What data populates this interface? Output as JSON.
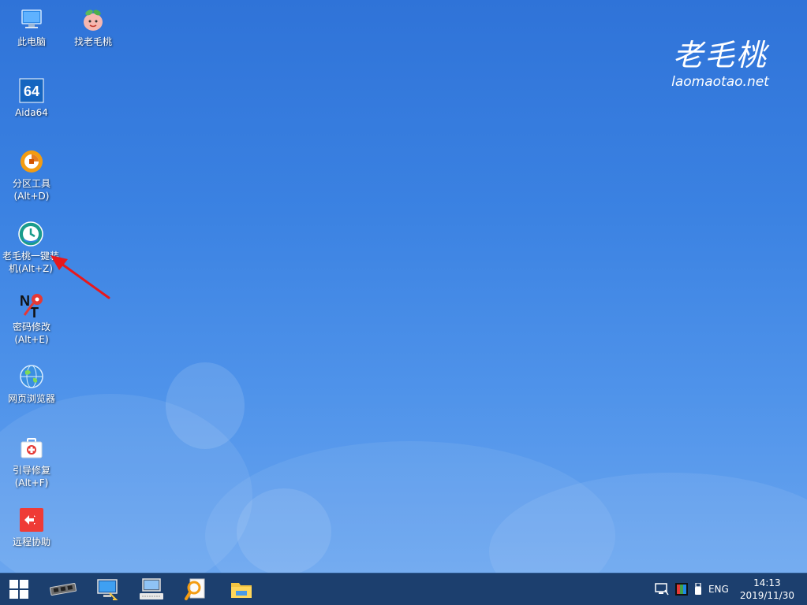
{
  "logo": {
    "title": "老毛桃",
    "url": "laomaotao.net"
  },
  "desktop_icons": [
    {
      "label": "此电脑",
      "icon": "computer-icon"
    },
    {
      "label": "找老毛桃",
      "icon": "peach-icon"
    },
    {
      "label": "Aida64",
      "icon": "aida64-icon"
    },
    {
      "label": "分区工具\n(Alt+D)",
      "icon": "partition-tool-icon"
    },
    {
      "label": "老毛桃一键装\n机(Alt+Z)",
      "icon": "one-click-install-icon"
    },
    {
      "label": "密码修改\n(Alt+E)",
      "icon": "password-key-icon"
    },
    {
      "label": "网页浏览器",
      "icon": "globe-icon"
    },
    {
      "label": "引导修复\n(Alt+F)",
      "icon": "first-aid-kit-icon"
    },
    {
      "label": "远程协助",
      "icon": "remote-assist-icon"
    }
  ],
  "taskbar": {
    "items": [
      "start-icon",
      "memory-chip-icon",
      "network-computer-icon",
      "keyboard-computer-icon",
      "search-doc-icon",
      "file-explorer-icon"
    ],
    "tray": {
      "lang": "ENG",
      "time": "14:13",
      "date": "2019/11/30"
    }
  },
  "colors": {
    "desktop_top": "#2f73d8",
    "desktop_bottom": "#6fa9f0",
    "taskbar": "#1c3f6e",
    "arrow": "#e8181c"
  }
}
